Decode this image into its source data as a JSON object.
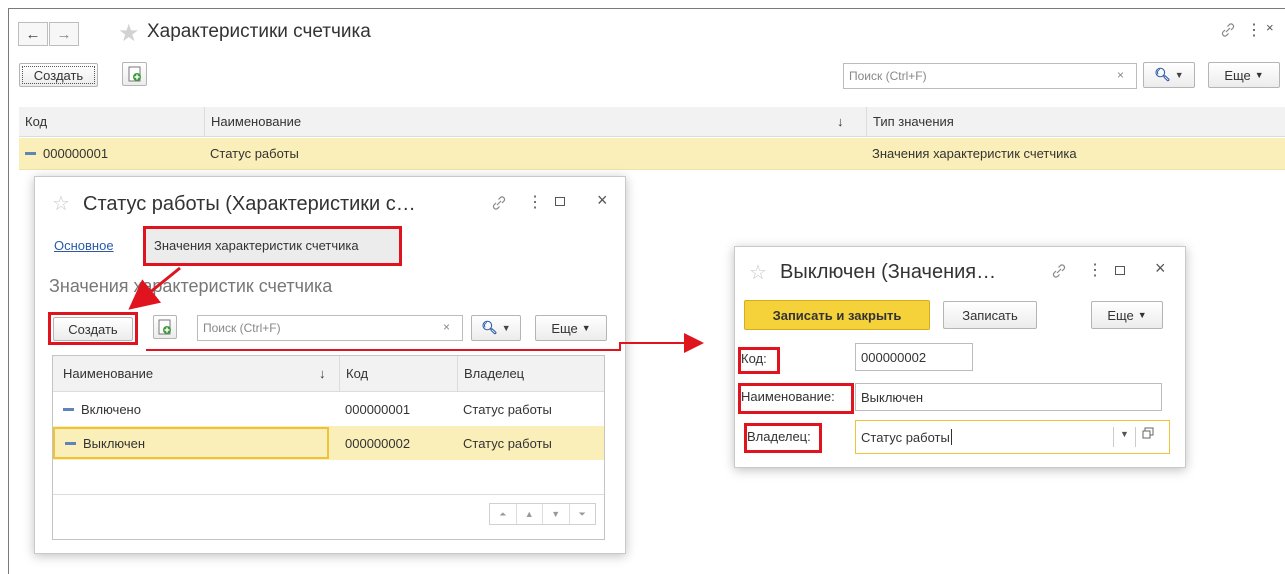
{
  "main": {
    "title": "Характеристики счетчика",
    "create_label": "Создать",
    "search_placeholder": "Поиск (Ctrl+F)",
    "more_label": "Еще",
    "columns": [
      "Код",
      "Наименование",
      "Тип значения"
    ],
    "sort_indicator": "↓",
    "row": {
      "code": "000000001",
      "name": "Статус работы",
      "type": "Значения характеристик счетчика"
    }
  },
  "dialog1": {
    "title": "Статус работы (Характеристики с…",
    "tabs": [
      "Основное",
      "Значения характеристик счетчика"
    ],
    "section_title": "Значения характеристик счетчика",
    "create_label": "Создать",
    "search_placeholder": "Поиск (Ctrl+F)",
    "more_label": "Еще",
    "columns": [
      "Наименование",
      "Код",
      "Владелец"
    ],
    "sort_indicator": "↓",
    "rows": [
      {
        "name": "Включено",
        "code": "000000001",
        "owner": "Статус работы"
      },
      {
        "name": "Выключен",
        "code": "000000002",
        "owner": "Статус работы"
      }
    ]
  },
  "dialog2": {
    "title": "Выключен (Значения…",
    "save_close_label": "Записать и закрыть",
    "save_label": "Записать",
    "more_label": "Еще",
    "fields": {
      "code_label": "Код:",
      "code_value": "000000002",
      "name_label": "Наименование:",
      "name_value": "Выключен",
      "owner_label": "Владелец:",
      "owner_value": "Статус работы"
    }
  },
  "colors": {
    "accent_yellow": "#f6d23a",
    "selection": "#fbefb9",
    "annotation_red": "#e0141e",
    "link_blue": "#2a5aa8"
  },
  "icons": [
    "back-arrow-icon",
    "forward-arrow-icon",
    "star-icon",
    "link-icon",
    "more-vertical-icon",
    "maximize-icon",
    "close-icon",
    "add-copy-icon",
    "search-icon",
    "dropdown-icon",
    "open-icon"
  ]
}
